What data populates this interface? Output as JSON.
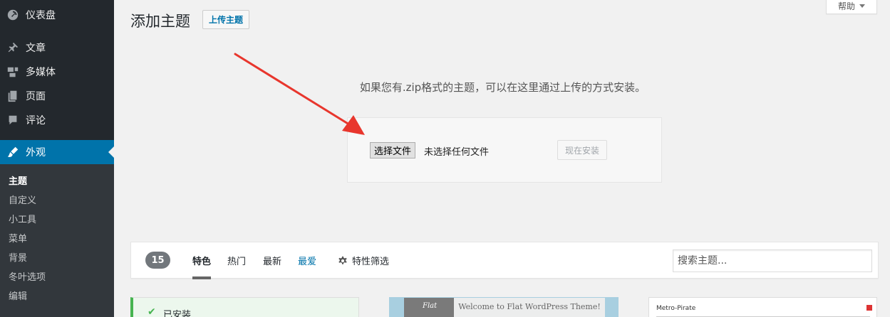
{
  "sidebar": {
    "items": [
      {
        "label": "仪表盘",
        "icon": "dashboard-icon"
      },
      {
        "label": "文章",
        "icon": "pin-icon"
      },
      {
        "label": "多媒体",
        "icon": "media-icon"
      },
      {
        "label": "页面",
        "icon": "page-icon"
      },
      {
        "label": "评论",
        "icon": "comment-icon"
      },
      {
        "label": "外观",
        "icon": "brush-icon"
      }
    ],
    "submenu": [
      "主题",
      "自定义",
      "小工具",
      "菜单",
      "背景",
      "冬叶选项",
      "编辑"
    ],
    "accent_color": "#0073aa"
  },
  "header": {
    "title": "添加主题",
    "upload_button": "上传主题",
    "help_tab": "帮助"
  },
  "upload": {
    "description": "如果您有.zip格式的主题，可以在这里通过上传的方式安装。",
    "choose_file": "选择文件",
    "file_status": "未选择任何文件",
    "install_button": "现在安装"
  },
  "filter": {
    "count": "15",
    "tabs": [
      "特色",
      "热门",
      "最新",
      "最爱"
    ],
    "feature_filter": "特性筛选",
    "search_placeholder": "搜索主题..."
  },
  "themes": {
    "installed_label": "已安装",
    "card2_brand": "Flat",
    "card2_title": "Welcome to Flat WordPress Theme!",
    "card3_logo": "Metro-Pirate"
  }
}
